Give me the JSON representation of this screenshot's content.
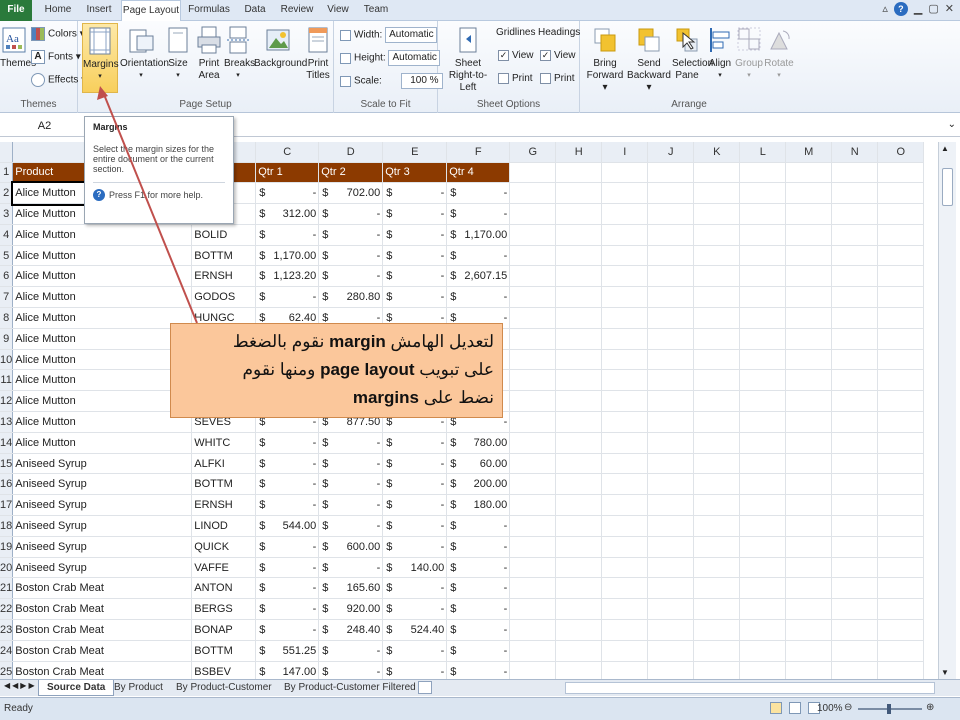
{
  "tabs": [
    {
      "label": "File"
    },
    {
      "label": "Home"
    },
    {
      "label": "Insert"
    },
    {
      "label": "Page Layout"
    },
    {
      "label": "Formulas"
    },
    {
      "label": "Data"
    },
    {
      "label": "Review"
    },
    {
      "label": "View"
    },
    {
      "label": "Team"
    }
  ],
  "ribbon": {
    "themes": {
      "button": "Themes",
      "colors": "Colors",
      "fonts": "Fonts",
      "effects": "Effects",
      "group": "Themes"
    },
    "page_setup": {
      "margins": "Margins",
      "orientation": "Orientation",
      "size": "Size",
      "print_area_1": "Print",
      "print_area_2": "Area",
      "breaks": "Breaks",
      "background": "Background",
      "print_titles_1": "Print",
      "print_titles_2": "Titles",
      "group": "Page Setup"
    },
    "scale": {
      "width_label": "Width:",
      "width_value": "Automatic",
      "height_label": "Height:",
      "height_value": "Automatic",
      "scale_label": "Scale:",
      "scale_value": "100 %",
      "group": "Scale to Fit"
    },
    "sheet_options": {
      "sheet_rtl_1": "Sheet",
      "sheet_rtl_2": "Right-to-Left",
      "gridlines": "Gridlines",
      "headings": "Headings",
      "view": "View",
      "print": "Print",
      "group": "Sheet Options"
    },
    "arrange": {
      "bring_1": "Bring",
      "bring_2": "Forward",
      "send_1": "Send",
      "send_2": "Backward",
      "selection_1": "Selection",
      "selection_2": "Pane",
      "align": "Align",
      "group_btn": "Group",
      "rotate": "Rotate",
      "group": "Arrange"
    }
  },
  "formula_bar": {
    "name_box": "A2"
  },
  "tooltip": {
    "title": "Margins",
    "body": "Select the margin sizes for the entire document or the current section.",
    "help": "Press F1 for more help."
  },
  "columns": [
    "C",
    "D",
    "E",
    "F",
    "G",
    "H",
    "I",
    "J",
    "K",
    "L",
    "M",
    "N",
    "O"
  ],
  "header_row": {
    "row": "1",
    "product": "Product",
    "qtr1": "Qtr 1",
    "qtr2": "Qtr 2",
    "qtr3": "Qtr 3",
    "qtr4": "Qtr 4"
  },
  "rows": [
    {
      "n": "2",
      "product": "Alice Mutton",
      "customer": "",
      "q": [
        "-",
        "702.00",
        "-",
        "-"
      ]
    },
    {
      "n": "3",
      "product": "Alice Mutton",
      "customer": "",
      "q": [
        "312.00",
        "-",
        "-",
        "-"
      ]
    },
    {
      "n": "4",
      "product": "Alice Mutton",
      "customer": "BOLID",
      "q": [
        "-",
        "-",
        "-",
        "1,170.00"
      ]
    },
    {
      "n": "5",
      "product": "Alice Mutton",
      "customer": "BOTTM",
      "q": [
        "1,170.00",
        "-",
        "-",
        "-"
      ]
    },
    {
      "n": "6",
      "product": "Alice Mutton",
      "customer": "ERNSH",
      "q": [
        "1,123.20",
        "-",
        "-",
        "2,607.15"
      ]
    },
    {
      "n": "7",
      "product": "Alice Mutton",
      "customer": "GODOS",
      "q": [
        "-",
        "280.80",
        "-",
        "-"
      ]
    },
    {
      "n": "8",
      "product": "Alice Mutton",
      "customer": "HUNGC",
      "q": [
        "62.40",
        "-",
        "-",
        "-"
      ]
    },
    {
      "n": "9",
      "product": "Alice Mutton",
      "customer": "",
      "q": [
        "",
        "",
        "",
        ""
      ]
    },
    {
      "n": "10",
      "product": "Alice Mutton",
      "customer": "",
      "q": [
        "",
        "",
        "",
        ""
      ]
    },
    {
      "n": "11",
      "product": "Alice Mutton",
      "customer": "",
      "q": [
        "",
        "",
        "",
        ""
      ]
    },
    {
      "n": "12",
      "product": "Alice Mutton",
      "customer": "",
      "q": [
        "",
        "",
        "",
        ""
      ]
    },
    {
      "n": "13",
      "product": "Alice Mutton",
      "customer": "SEVES",
      "q": [
        "-",
        "877.50",
        "-",
        "-"
      ]
    },
    {
      "n": "14",
      "product": "Alice Mutton",
      "customer": "WHITC",
      "q": [
        "-",
        "-",
        "-",
        "780.00"
      ]
    },
    {
      "n": "15",
      "product": "Aniseed Syrup",
      "customer": "ALFKI",
      "q": [
        "-",
        "-",
        "-",
        "60.00"
      ]
    },
    {
      "n": "16",
      "product": "Aniseed Syrup",
      "customer": "BOTTM",
      "q": [
        "-",
        "-",
        "-",
        "200.00"
      ]
    },
    {
      "n": "17",
      "product": "Aniseed Syrup",
      "customer": "ERNSH",
      "q": [
        "-",
        "-",
        "-",
        "180.00"
      ]
    },
    {
      "n": "18",
      "product": "Aniseed Syrup",
      "customer": "LINOD",
      "q": [
        "544.00",
        "-",
        "-",
        "-"
      ]
    },
    {
      "n": "19",
      "product": "Aniseed Syrup",
      "customer": "QUICK",
      "q": [
        "-",
        "600.00",
        "-",
        "-"
      ]
    },
    {
      "n": "20",
      "product": "Aniseed Syrup",
      "customer": "VAFFE",
      "q": [
        "-",
        "-",
        "140.00",
        "-"
      ]
    },
    {
      "n": "21",
      "product": "Boston Crab Meat",
      "customer": "ANTON",
      "q": [
        "-",
        "165.60",
        "-",
        "-"
      ]
    },
    {
      "n": "22",
      "product": "Boston Crab Meat",
      "customer": "BERGS",
      "q": [
        "-",
        "920.00",
        "-",
        "-"
      ]
    },
    {
      "n": "23",
      "product": "Boston Crab Meat",
      "customer": "BONAP",
      "q": [
        "-",
        "248.40",
        "524.40",
        "-"
      ]
    },
    {
      "n": "24",
      "product": "Boston Crab Meat",
      "customer": "BOTTM",
      "q": [
        "551.25",
        "-",
        "-",
        "-"
      ]
    },
    {
      "n": "25",
      "product": "Boston Crab Meat",
      "customer": "BSBEV",
      "q": [
        "147.00",
        "-",
        "-",
        "-"
      ]
    }
  ],
  "currency": "$",
  "sheet_tabs": [
    {
      "label": "Source Data"
    },
    {
      "label": "By Product"
    },
    {
      "label": "By Product-Customer"
    },
    {
      "label": "By Product-Customer Filtered"
    }
  ],
  "status": {
    "ready": "Ready",
    "zoom": "100%"
  },
  "callout": {
    "line1_a": "لتعديل الهامش ",
    "line1_b": "margin",
    "line1_c": " نقوم بالضغط",
    "line2_a": "على تبويب ",
    "line2_b": "page layout",
    "line2_c": " ومنها نقوم",
    "line3_a": "نضط على ",
    "line3_b": "margins"
  }
}
